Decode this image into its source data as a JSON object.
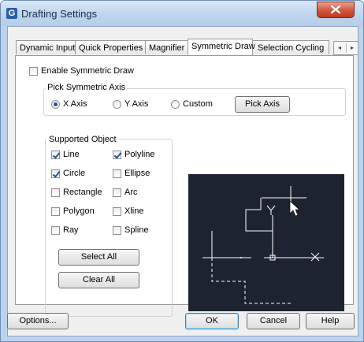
{
  "window": {
    "title": "Drafting Settings",
    "close_icon": "close-icon",
    "app_icon": "gcad-app-icon",
    "app_icon_letter": "G"
  },
  "tabs": [
    {
      "label": "Dynamic Input"
    },
    {
      "label": "Quick Properties"
    },
    {
      "label": "Magnifier"
    },
    {
      "label": "Symmetric Draw",
      "active": true
    },
    {
      "label": "Selection Cycling"
    }
  ],
  "tab_scroll": {
    "left_icon": "arrow-left-icon",
    "right_icon": "arrow-right-icon",
    "left_glyph": "◂",
    "right_glyph": "▸"
  },
  "symmetric": {
    "enable_label": "Enable Symmetric Draw",
    "enable_checked": false,
    "pick_axis_group": "Pick Symmetric Axis",
    "axis_options": [
      {
        "label": "X Axis",
        "selected": true
      },
      {
        "label": "Y Axis",
        "selected": false
      },
      {
        "label": "Custom",
        "selected": false
      }
    ],
    "pick_axis_button": "Pick Axis"
  },
  "supported": {
    "group_label": "Supported Object",
    "objects": [
      {
        "label": "Line",
        "checked": true
      },
      {
        "label": "Polyline",
        "checked": true
      },
      {
        "label": "Circle",
        "checked": true
      },
      {
        "label": "Ellipse",
        "checked": false
      },
      {
        "label": "Rectangle",
        "checked": false
      },
      {
        "label": "Arc",
        "checked": false
      },
      {
        "label": "Polygon",
        "checked": false
      },
      {
        "label": "Xline",
        "checked": false
      },
      {
        "label": "Ray",
        "checked": false
      },
      {
        "label": "Spline",
        "checked": false
      }
    ],
    "select_all": "Select All",
    "clear_all": "Clear All"
  },
  "preview": {
    "y_label": "Y",
    "x_label": "X",
    "background": "#1d2330",
    "line_color": "#ffffff",
    "cursor_icon": "pointer-cursor-icon"
  },
  "footer": {
    "options": "Options...",
    "ok": "OK",
    "cancel": "Cancel",
    "help": "Help"
  },
  "colors": {
    "title_bar": "#c0d5ee",
    "close_button": "#cf5a42",
    "check_color": "#1f4f9c"
  }
}
